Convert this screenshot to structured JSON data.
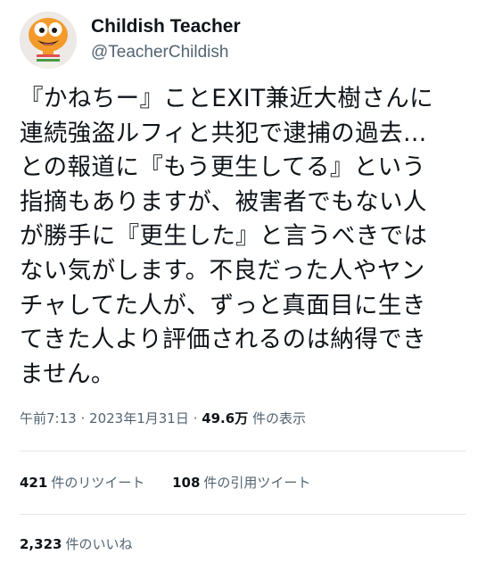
{
  "author": {
    "display_name": "Childish Teacher",
    "handle": "@TeacherChildish"
  },
  "tweet": {
    "lines": [
      "『かねちー』ことEXIT兼近大樹さんに",
      "連続強盗ルフィと共犯で逮捕の過去…",
      "との報道に『もう更生してる』という",
      "指摘もありますが、被害者でもない人",
      "が勝手に『更生した』と言うべきでは",
      "ない気がします。不良だった人やヤン",
      "チャしてた人が、ずっと真面目に生き",
      "てきた人より評価されるのは納得でき",
      "ません。"
    ]
  },
  "meta": {
    "time": "午前7:13",
    "separator": "·",
    "date": "2023年1月31日",
    "views_count": "49.6万",
    "views_label": "件の表示"
  },
  "stats": {
    "retweets_count": "421",
    "retweets_label": "件のリツイート",
    "quotes_count": "108",
    "quotes_label": "件の引用ツイート",
    "likes_count": "2,323",
    "likes_label": "件のいいね"
  },
  "colors": {
    "text": "#0f1419",
    "secondary": "#536471",
    "divider": "#e3e6e8",
    "avatar_orange": "#f39a2b"
  }
}
